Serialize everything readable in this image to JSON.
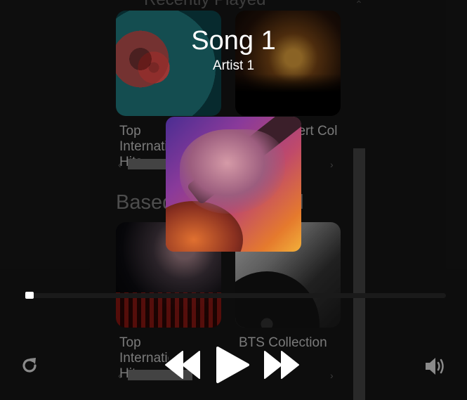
{
  "library": {
    "top_heading": "Recently Played",
    "section_heading": "Based on your mood",
    "albums": [
      {
        "label": "Top International Hits",
        "image": "vinyl-record"
      },
      {
        "label": "Live Concert Collection",
        "image": "concert-crowd"
      },
      {
        "label": "Top International Hits",
        "image": "stage-lights"
      },
      {
        "label": "BTS Collection",
        "image": "turntable"
      }
    ],
    "scroll_left_glyph": "‹",
    "scroll_right_glyph": "›",
    "scroll_up_glyph": "⌃"
  },
  "player": {
    "title": "Song 1",
    "artist": "Artist 1",
    "cover_image": "guitar-player",
    "progress": 0.0,
    "controls": {
      "repeat_icon": "repeat-icon",
      "prev_icon": "rewind-icon",
      "play_icon": "play-icon",
      "next_icon": "fast-forward-icon",
      "volume_icon": "volume-icon"
    }
  },
  "colors": {
    "background": "#000000",
    "text": "#ffffff",
    "muted_text": "#aaaaaa",
    "scrollbar": "#5e5e5e"
  }
}
